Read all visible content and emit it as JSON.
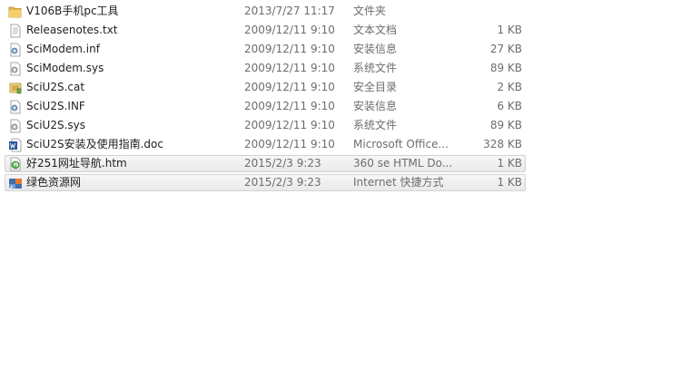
{
  "files": [
    {
      "name": "V106B手机pc工具",
      "date": "2013/7/27 11:17",
      "type": "文件夹",
      "size": "",
      "icon": "folder-icon",
      "selected": false
    },
    {
      "name": "Releasenotes.txt",
      "date": "2009/12/11 9:10",
      "type": "文本文档",
      "size": "1 KB",
      "icon": "text-file-icon",
      "selected": false
    },
    {
      "name": "SciModem.inf",
      "date": "2009/12/11 9:10",
      "type": "安装信息",
      "size": "27 KB",
      "icon": "setup-info-icon",
      "selected": false
    },
    {
      "name": "SciModem.sys",
      "date": "2009/12/11 9:10",
      "type": "系统文件",
      "size": "89 KB",
      "icon": "system-file-icon",
      "selected": false
    },
    {
      "name": "SciU2S.cat",
      "date": "2009/12/11 9:10",
      "type": "安全目录",
      "size": "2 KB",
      "icon": "security-catalog-icon",
      "selected": false
    },
    {
      "name": "SciU2S.INF",
      "date": "2009/12/11 9:10",
      "type": "安装信息",
      "size": "6 KB",
      "icon": "setup-info-icon",
      "selected": false
    },
    {
      "name": "SciU2S.sys",
      "date": "2009/12/11 9:10",
      "type": "系统文件",
      "size": "89 KB",
      "icon": "system-file-icon",
      "selected": false
    },
    {
      "name": "SciU2S安装及使用指南.doc",
      "date": "2009/12/11 9:10",
      "type": "Microsoft Office...",
      "size": "328 KB",
      "icon": "word-document-icon",
      "selected": false
    },
    {
      "name": "好251网址导航.htm",
      "date": "2015/2/3 9:23",
      "type": "360 se HTML Do...",
      "size": "1 KB",
      "icon": "html-file-icon",
      "selected": true
    },
    {
      "name": "绿色资源网",
      "date": "2015/2/3 9:23",
      "type": "Internet 快捷方式",
      "size": "1 KB",
      "icon": "internet-shortcut-icon",
      "selected": true
    }
  ]
}
